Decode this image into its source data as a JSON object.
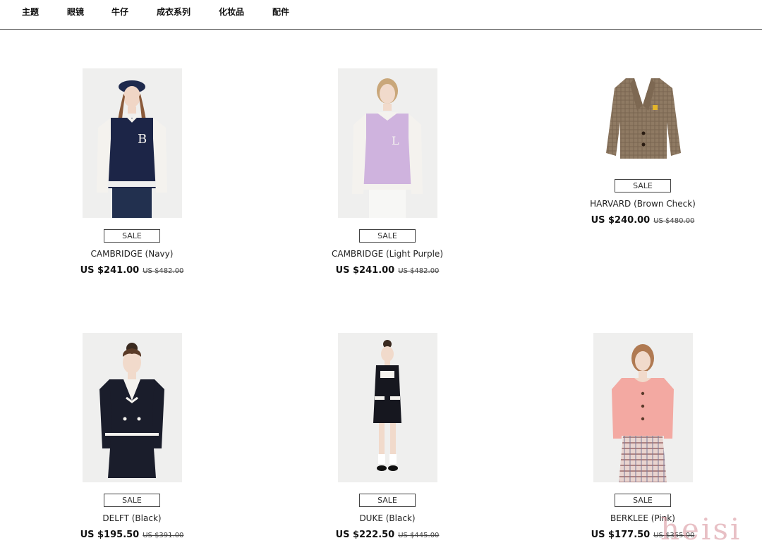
{
  "nav": {
    "items": [
      {
        "label": "主题"
      },
      {
        "label": "眼镜"
      },
      {
        "label": "牛仔"
      },
      {
        "label": "成衣系列"
      },
      {
        "label": "化妆品"
      },
      {
        "label": "配件"
      }
    ]
  },
  "products": [
    {
      "badge": "SALE",
      "name": "CAMBRIDGE (Navy)",
      "price": "US $241.00",
      "old_price": "US $482.00"
    },
    {
      "badge": "SALE",
      "name": "CAMBRIDGE (Light Purple)",
      "price": "US $241.00",
      "old_price": "US $482.00"
    },
    {
      "badge": "SALE",
      "name": "HARVARD (Brown Check)",
      "price": "US $240.00",
      "old_price": "US $480.00"
    },
    {
      "badge": "SALE",
      "name": "DELFT (Black)",
      "price": "US $195.50",
      "old_price": "US $391.00"
    },
    {
      "badge": "SALE",
      "name": "DUKE (Black)",
      "price": "US $222.50",
      "old_price": "US $445.00"
    },
    {
      "badge": "SALE",
      "name": "BERKLEE (Pink)",
      "price": "US $177.50",
      "old_price": "US $355.00"
    }
  ],
  "watermark": "heisi",
  "colors": {
    "background": "#ffffff",
    "text": "#222222",
    "divider": "#555555",
    "watermark": "#d68c96"
  }
}
